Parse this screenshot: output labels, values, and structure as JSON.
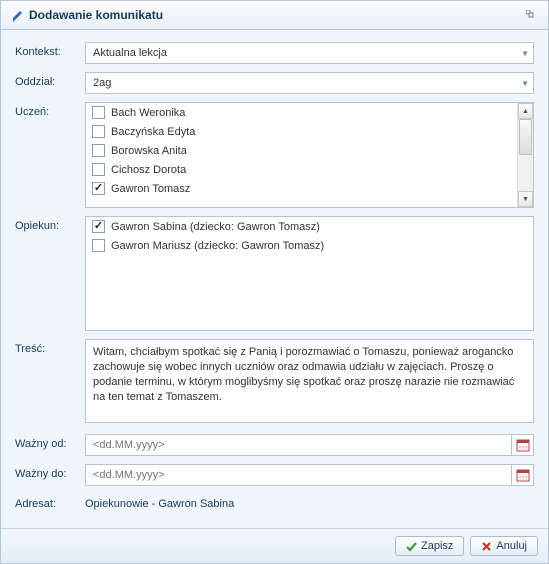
{
  "window": {
    "title": "Dodawanie komunikatu"
  },
  "labels": {
    "kontekst": "Kontekst:",
    "oddzial": "Oddział:",
    "uczen": "Uczeń:",
    "opiekun": "Opiekun:",
    "tresc": "Treść:",
    "wazny_od": "Ważny od:",
    "wazny_do": "Ważny do:",
    "adresat": "Adresat:"
  },
  "fields": {
    "kontekst_value": "Aktualna lekcja",
    "oddzial_value": "2ag",
    "students": [
      {
        "label": "Bach Weronika",
        "checked": false
      },
      {
        "label": "Baczyńska Edyta",
        "checked": false
      },
      {
        "label": "Borowska Anita",
        "checked": false
      },
      {
        "label": "Cichosz Dorota",
        "checked": false
      },
      {
        "label": "Gawron Tomasz",
        "checked": true
      }
    ],
    "guardians": [
      {
        "label": "Gawron Sabina (dziecko: Gawron Tomasz)",
        "checked": true
      },
      {
        "label": "Gawron Mariusz (dziecko: Gawron Tomasz)",
        "checked": false
      }
    ],
    "tresc_value": "Witam, chciałbym spotkać się z Panią i porozmawiać o Tomaszu, ponieważ arogancko zachowuje się wobec innych uczniów oraz odmawia udziału w zajęciach. Proszę o podanie terminu, w którym moglibyśmy się spotkać oraz proszę narazie nie rozmawiać na ten temat z Tomaszem.",
    "date_placeholder": "<dd.MM.yyyy>",
    "adresat_value": "Opiekunowie - Gawron Sabina"
  },
  "buttons": {
    "zapisz": "Zapisz",
    "anuluj": "Anuluj"
  }
}
